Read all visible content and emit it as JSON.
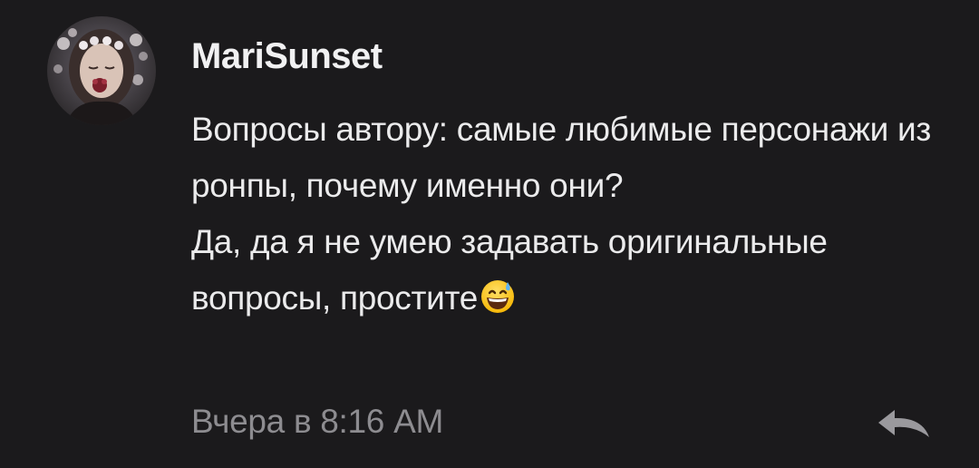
{
  "comment": {
    "username": "MariSunset",
    "lines": [
      "Вопросы автору: самые любимые персонажи из ронпы, почему именно они?",
      "Да, да я не умею задавать оригинальные вопросы, простите"
    ],
    "emoji": "grinning-face-with-sweat",
    "timestamp": "Вчера в 8:16 AM",
    "reply_icon": "reply-arrow-icon"
  },
  "colors": {
    "background": "#1b1a1c",
    "text": "#ebebec",
    "muted": "#8d8c90"
  }
}
